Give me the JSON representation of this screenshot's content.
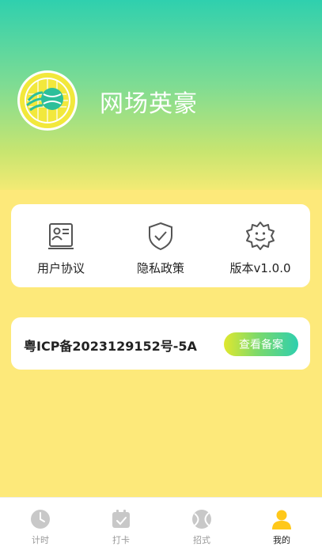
{
  "app": {
    "name": "网场英豪",
    "logo_icon": "tennis-ball-logo-icon"
  },
  "menu": [
    {
      "label": "用户协议",
      "icon": "id-card-icon"
    },
    {
      "label": "隐私政策",
      "icon": "shield-check-icon"
    },
    {
      "label": "版本v1.0.0",
      "icon": "gear-smile-icon"
    }
  ],
  "icp": {
    "text": "粤ICP备2023129152号-5A",
    "button_label": "查看备案"
  },
  "tabs": [
    {
      "label": "计时",
      "icon": "clock-icon",
      "active": false
    },
    {
      "label": "打卡",
      "icon": "calendar-check-icon",
      "active": false
    },
    {
      "label": "招式",
      "icon": "ball-icon",
      "active": false
    },
    {
      "label": "我的",
      "icon": "user-icon",
      "active": true
    }
  ],
  "colors": {
    "accent": "#2ecfae",
    "active_tab": "#ffc81a",
    "background": "#fde97a"
  }
}
